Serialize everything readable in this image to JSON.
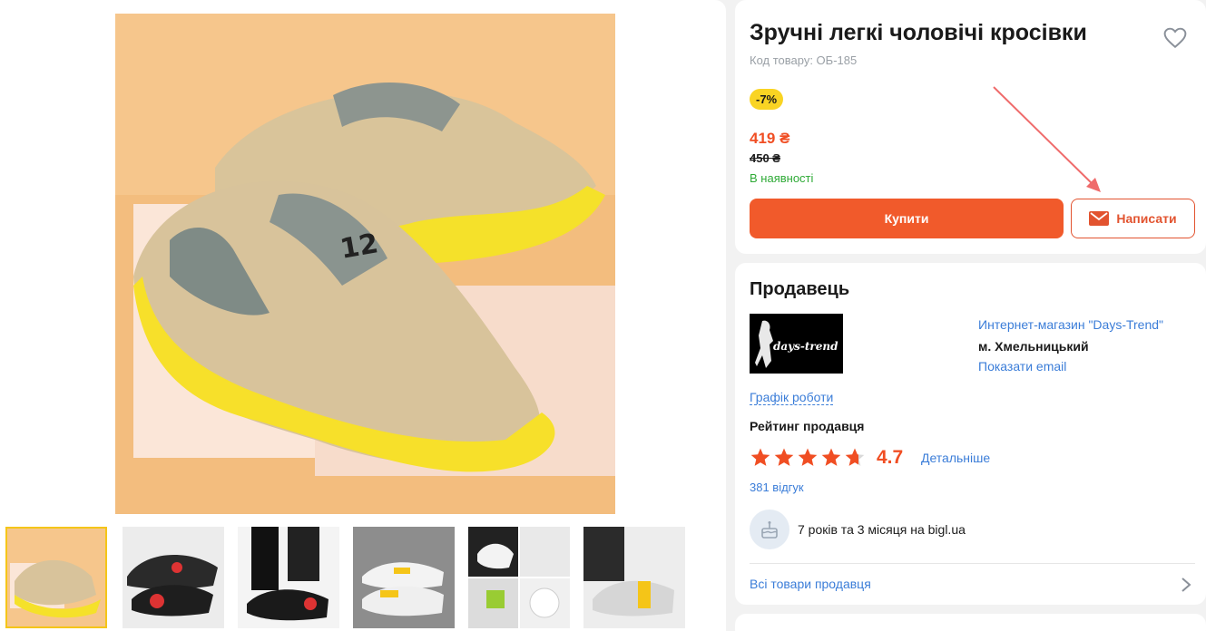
{
  "product": {
    "title": "Зручні легкі чоловічі кросівки",
    "code": "Код товару: ОБ-185",
    "discount_badge": "-7%",
    "price": "419 ₴",
    "old_price": "450 ₴",
    "availability": "В наявності",
    "buy_label": "Купити",
    "write_label": "Написати"
  },
  "seller": {
    "heading": "Продавець",
    "logo_text": "days-trend",
    "name": "Интернет-магазин \"Days-Trend\"",
    "city": "м. Хмельницький",
    "show_email": "Показати email",
    "schedule": "Графік роботи",
    "rating_heading": "Рейтинг продавця",
    "rating_value": "4.7",
    "rating_stars": 4.7,
    "details_link": "Детальніше",
    "reviews": "381 відгук",
    "tenure": "7 років та 3 місяця на bigl.ua",
    "all_goods": "Всі товари продавця"
  },
  "gallery": {
    "thumbnail_count": 6,
    "active_thumbnail": 1
  },
  "colors": {
    "accent": "#f15a2b",
    "price": "#f04e23",
    "link": "#3b7dd8",
    "in_stock": "#2eaa36",
    "badge": "#f9d423"
  },
  "icons": {
    "favorite": "heart-icon",
    "write": "mail-icon",
    "tenure": "cake-icon",
    "all_goods": "chevron-right-icon",
    "rating": "star-icon"
  }
}
